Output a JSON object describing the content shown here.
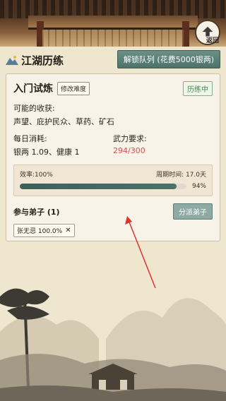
{
  "header": {
    "back_label": "返回",
    "title": "江湖历练",
    "unlock_button": "解锁队列 (花费5000银两)"
  },
  "card": {
    "task_name": "入门试炼",
    "difficulty_button": "修改难度",
    "status": "历练中",
    "rewards_label": "可能的收获:",
    "rewards_value": "声望、庇护民众、草药、矿石",
    "daily_cost_label": "每日消耗:",
    "daily_cost_value": "银两 1.09、健康 1",
    "power_label": "武力要求:",
    "power_value": "294/300",
    "efficiency_label": "效率:100%",
    "cycle_label": "周期时间: 17.0天",
    "progress_percent_label": "94%",
    "progress_fraction": 0.94,
    "members_title": "参与弟子 (1)",
    "assign_button": "分派弟子",
    "members": [
      {
        "name": "张无忌 100.0%"
      }
    ]
  },
  "colors": {
    "accent": "#4d7268",
    "warning": "#d9534f",
    "status_green": "#3f8a4a"
  }
}
